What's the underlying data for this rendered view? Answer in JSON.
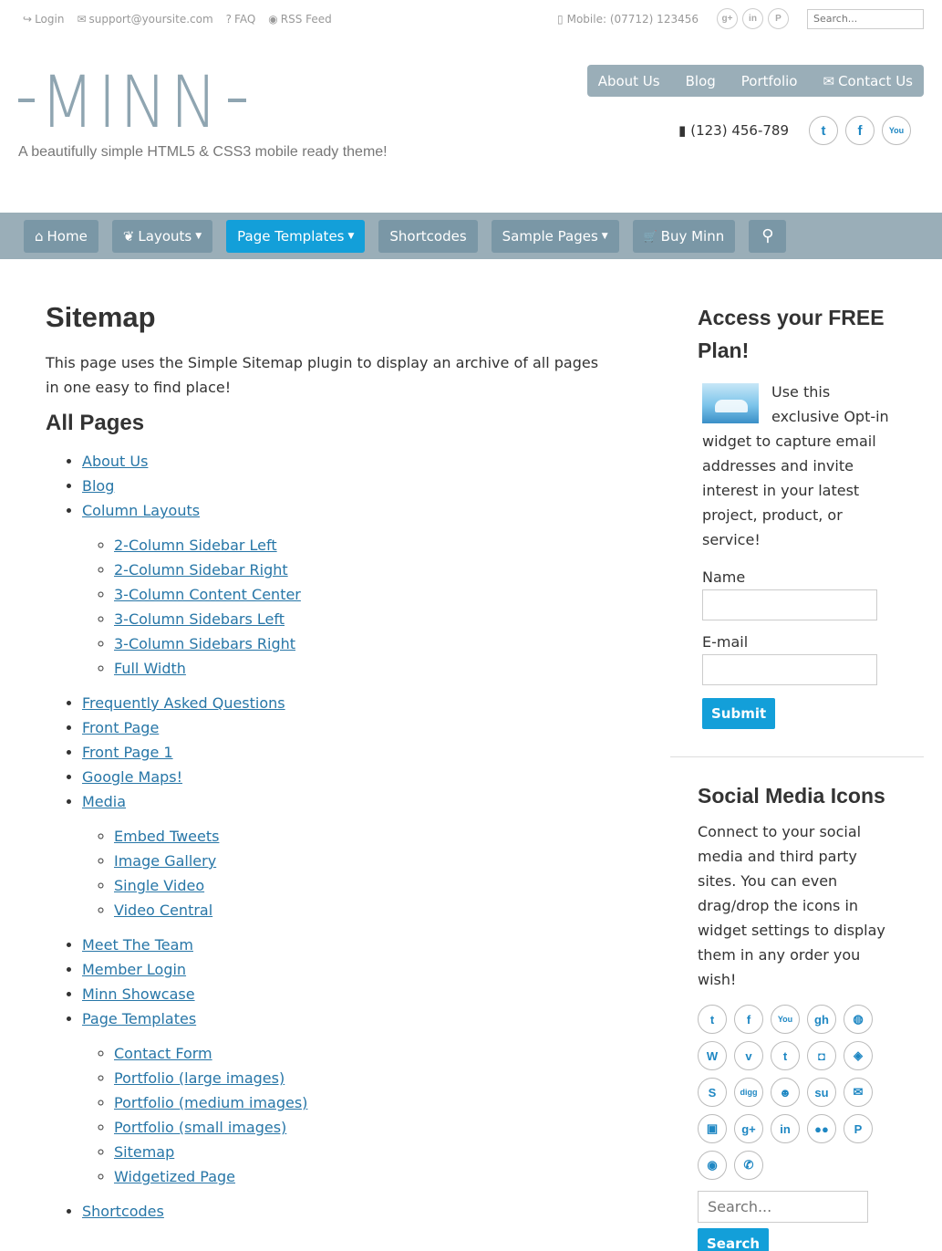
{
  "top_bar": {
    "links": [
      {
        "icon": "share-icon",
        "glyph": "↪",
        "label": "Login"
      },
      {
        "icon": "envelope-icon",
        "glyph": "✉",
        "label": "support@yoursite.com"
      },
      {
        "icon": "question-icon",
        "glyph": "?",
        "label": "FAQ"
      },
      {
        "icon": "rss-icon",
        "glyph": "◉",
        "label": "RSS Feed"
      }
    ],
    "mobile_label": "Mobile: (07712) 123456",
    "social": [
      {
        "icon": "google-plus-icon",
        "glyph": "g+"
      },
      {
        "icon": "linkedin-icon",
        "glyph": "in"
      },
      {
        "icon": "pinterest-icon",
        "glyph": "P"
      }
    ],
    "search_placeholder": "Search..."
  },
  "header": {
    "logo_text": "MINN",
    "tagline": "A beautifully simple HTML5 & CSS3 mobile ready theme!",
    "nav": [
      "About Us",
      "Blog",
      "Portfolio",
      "Contact Us"
    ],
    "phone": "(123) 456-789",
    "social": [
      {
        "icon": "twitter-icon",
        "glyph": "t"
      },
      {
        "icon": "facebook-icon",
        "glyph": "f"
      },
      {
        "icon": "youtube-icon",
        "glyph": "You"
      }
    ]
  },
  "main_nav": [
    {
      "label": "Home",
      "icon": "home-icon",
      "glyph": "⌂",
      "dropdown": false,
      "active": false
    },
    {
      "label": "Layouts",
      "icon": "leaf-icon",
      "glyph": "❦",
      "dropdown": true,
      "active": false
    },
    {
      "label": "Page Templates",
      "icon": "",
      "glyph": "",
      "dropdown": true,
      "active": true
    },
    {
      "label": "Shortcodes",
      "icon": "",
      "glyph": "",
      "dropdown": false,
      "active": false
    },
    {
      "label": "Sample Pages",
      "icon": "",
      "glyph": "",
      "dropdown": true,
      "active": false
    },
    {
      "label": "Buy Minn",
      "icon": "cart-icon",
      "glyph": "🛒",
      "dropdown": false,
      "active": false
    },
    {
      "label": "",
      "icon": "search-icon",
      "glyph": "⚲",
      "dropdown": false,
      "active": false
    }
  ],
  "content": {
    "title": "Sitemap",
    "intro": "This page uses the Simple Sitemap plugin to display an archive of all pages in one easy to find place!",
    "section_title": "All Pages",
    "pages": [
      {
        "label": "About Us"
      },
      {
        "label": "Blog"
      },
      {
        "label": "Column Layouts",
        "children": [
          "2-Column Sidebar Left",
          "2-Column Sidebar Right",
          "3-Column Content Center",
          "3-Column Sidebars Left",
          "3-Column Sidebars Right",
          "Full Width"
        ]
      },
      {
        "label": "Frequently Asked Questions"
      },
      {
        "label": "Front Page"
      },
      {
        "label": "Front Page 1"
      },
      {
        "label": "Google Maps!"
      },
      {
        "label": "Media",
        "children": [
          "Embed Tweets",
          "Image Gallery",
          "Single Video",
          "Video Central"
        ]
      },
      {
        "label": "Meet The Team"
      },
      {
        "label": "Member Login"
      },
      {
        "label": "Minn Showcase"
      },
      {
        "label": "Page Templates",
        "children": [
          "Contact Form",
          "Portfolio (large images)",
          "Portfolio (medium images)",
          "Portfolio (small images)",
          "Sitemap",
          "Widgetized Page"
        ]
      },
      {
        "label": "Shortcodes"
      }
    ]
  },
  "sidebar": {
    "optin": {
      "title": "Access your FREE Plan!",
      "text": "Use this exclusive Opt-in widget to capture email addresses and invite interest in your latest project, product, or service!",
      "name_label": "Name",
      "email_label": "E-mail",
      "submit_label": "Submit"
    },
    "social": {
      "title": "Social Media Icons",
      "text": "Connect to your social media and third party sites. You can even drag/drop the icons in widget settings to display them in any order you wish!",
      "icons": [
        {
          "icon": "twitter-icon",
          "glyph": "t"
        },
        {
          "icon": "facebook-icon",
          "glyph": "f"
        },
        {
          "icon": "youtube-icon",
          "glyph": "You"
        },
        {
          "icon": "github-icon",
          "glyph": "gh"
        },
        {
          "icon": "dribbble-icon",
          "glyph": "◍"
        },
        {
          "icon": "wordpress-icon",
          "glyph": "W"
        },
        {
          "icon": "vimeo-icon",
          "glyph": "v"
        },
        {
          "icon": "tumblr-icon",
          "glyph": "t"
        },
        {
          "icon": "instagram-icon",
          "glyph": "◘"
        },
        {
          "icon": "codepen-icon",
          "glyph": "◈"
        },
        {
          "icon": "skype-icon",
          "glyph": "S"
        },
        {
          "icon": "digg-icon",
          "glyph": "digg"
        },
        {
          "icon": "reddit-icon",
          "glyph": "☻"
        },
        {
          "icon": "stumbleupon-icon",
          "glyph": "su"
        },
        {
          "icon": "email-icon",
          "glyph": "✉"
        },
        {
          "icon": "trello-icon",
          "glyph": "▣"
        },
        {
          "icon": "google-plus-icon",
          "glyph": "g+"
        },
        {
          "icon": "linkedin-icon",
          "glyph": "in"
        },
        {
          "icon": "flickr-icon",
          "glyph": "●●"
        },
        {
          "icon": "pinterest-icon",
          "glyph": "P"
        },
        {
          "icon": "rss-icon",
          "glyph": "◉"
        },
        {
          "icon": "phone-icon",
          "glyph": "✆"
        }
      ]
    },
    "search": {
      "placeholder": "Search...",
      "button_label": "Search"
    }
  },
  "colors": {
    "accent": "#139fd9",
    "nav_bg": "#9aaeb8",
    "nav_button": "#7a97a6",
    "link": "#2776a7",
    "logo": "#8fa5b1"
  }
}
